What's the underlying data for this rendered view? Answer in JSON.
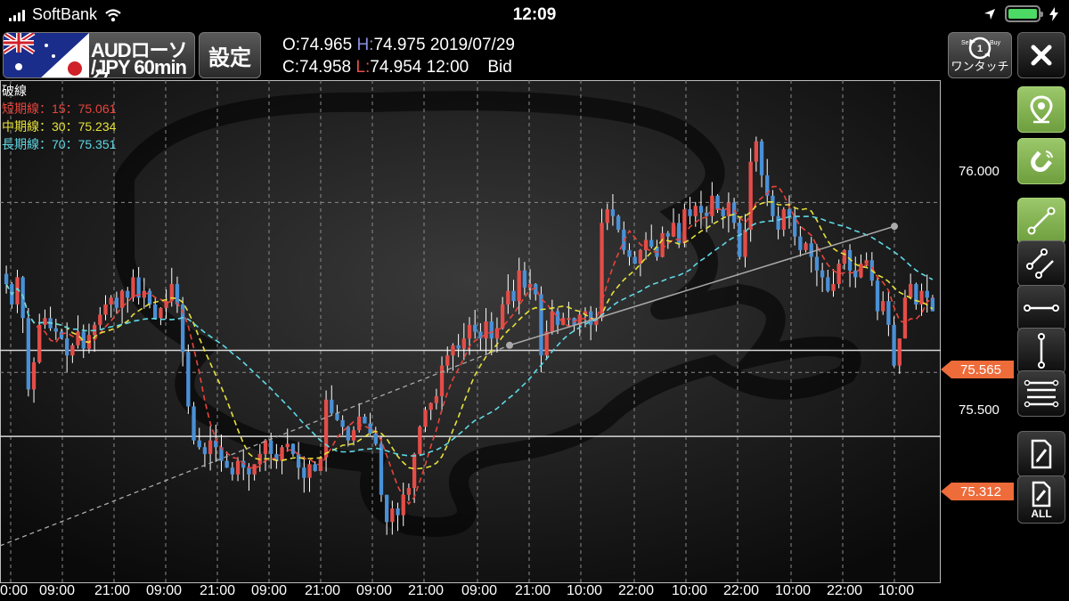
{
  "status": {
    "carrier": "SoftBank",
    "time": "12:09"
  },
  "header": {
    "pair_line1": "AUDローソク",
    "pair_line2": "/JPY 60min",
    "settings_label": "設定",
    "ohlc_line1": {
      "o": "O:74.965",
      "h": "H:",
      "hv": "74.975",
      "date": "2019/07/29"
    },
    "ohlc_line2": {
      "c": "C:74.958",
      "l": "L:",
      "lv": "74.954",
      "time": "12:00",
      "side": "Bid"
    }
  },
  "legend": {
    "title": "破線",
    "short": "短期線：15：75.061",
    "mid": "中期線：30：75.234",
    "long": "長期線：70：75.351"
  },
  "toolbar": {
    "onetouch_label": "ワンタッチ",
    "onetouch_sell": "Sell",
    "onetouch_buy": "Buy",
    "delete_all_label": "ALL"
  },
  "chart_data": {
    "type": "candlestick",
    "y_axis_labels": [
      "76.000",
      "75.500"
    ],
    "price_tags": [
      "75.565",
      "75.312"
    ],
    "x_tick_labels": [
      "0:00",
      "09:00",
      "21:00",
      "09:00",
      "21:00",
      "09:00",
      "21:00",
      "09:00",
      "21:00",
      "09:00",
      "21:00",
      "10:00",
      "22:00",
      "10:00",
      "22:00",
      "10:00",
      "22:00",
      "10:00"
    ],
    "ylim": [
      74.88,
      76.36
    ],
    "colors": {
      "up": "#e34d48",
      "down": "#4a90d6",
      "wick": "#ffffff",
      "short": "#e8443c",
      "mid": "#e6e23a",
      "long": "#5fd8e6",
      "trend": "#aaaaaa"
    },
    "close_path": [
      75.76,
      75.7,
      75.78,
      75.66,
      75.45,
      75.53,
      75.64,
      75.66,
      75.63,
      75.62,
      75.6,
      75.55,
      75.58,
      75.62,
      75.57,
      75.61,
      75.64,
      75.67,
      75.7,
      75.72,
      75.69,
      75.74,
      75.72,
      75.78,
      75.72,
      75.74,
      75.7,
      75.66,
      75.69,
      75.71,
      75.76,
      75.7,
      75.56,
      75.4,
      75.3,
      75.28,
      75.26,
      75.3,
      75.28,
      75.24,
      75.22,
      75.2,
      75.24,
      75.22,
      75.2,
      75.23,
      75.26,
      75.3,
      75.26,
      75.24,
      75.28,
      75.29,
      75.26,
      75.22,
      75.19,
      75.23,
      75.21,
      75.25,
      75.42,
      75.38,
      75.36,
      75.34,
      75.3,
      75.33,
      75.37,
      75.35,
      75.32,
      75.29,
      75.14,
      75.06,
      75.1,
      75.08,
      75.14,
      75.16,
      75.26,
      75.34,
      75.39,
      75.41,
      75.43,
      75.52,
      75.55,
      75.58,
      75.57,
      75.6,
      75.64,
      75.62,
      75.6,
      75.65,
      75.6,
      75.63,
      75.7,
      75.74,
      75.71,
      75.8,
      75.75,
      75.76,
      75.73,
      75.55,
      75.62,
      75.68,
      75.64,
      75.66,
      75.66,
      75.64,
      75.67,
      75.68,
      75.64,
      75.66,
      75.94,
      75.98,
      75.96,
      75.92,
      75.86,
      75.84,
      75.82,
      75.86,
      75.89,
      75.87,
      75.84,
      75.91,
      75.9,
      75.94,
      75.88,
      75.98,
      75.96,
      75.99,
      75.97,
      75.96,
      76.02,
      75.98,
      75.96,
      76.0,
      75.94,
      75.84,
      75.92,
      76.12,
      76.18,
      76.08,
      76.02,
      75.96,
      75.92,
      75.98,
      75.96,
      75.9,
      75.86,
      75.88,
      75.84,
      75.8,
      75.78,
      75.74,
      75.76,
      75.82,
      75.86,
      75.8,
      75.78,
      75.82,
      75.83,
      75.77,
      75.68,
      75.71,
      75.64,
      75.52,
      75.6,
      75.72,
      75.76,
      75.7,
      75.74,
      75.72,
      75.68
    ]
  }
}
